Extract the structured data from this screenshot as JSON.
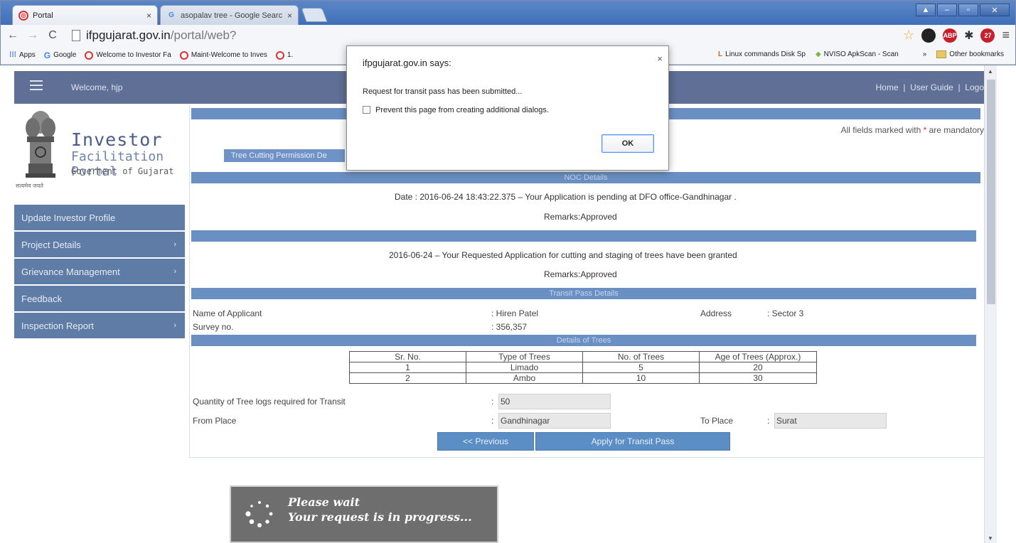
{
  "browser": {
    "tabs": [
      {
        "label": "Portal",
        "close": "×"
      },
      {
        "label": "asopalav tree - Google Searc",
        "close": "×"
      }
    ],
    "window_controls": {
      "user": "▲",
      "minimize": "–",
      "maximize": "▫",
      "close": "✕"
    },
    "address": {
      "host": "ifpgujarat.gov.in",
      "path": "/portal/web?"
    },
    "bookmarks": [
      "Apps",
      "Google",
      "Welcome to Investor Fa",
      "Maint-Welcome to Inves",
      "1.",
      "Linux commands Disk Sp",
      "NVISO ApkScan - Scan"
    ],
    "bookmarks_more": "»",
    "other_bookmarks": "Other bookmarks",
    "ext_badge": "27",
    "abp_label": "ABP"
  },
  "header": {
    "welcome": "Welcome, hjp",
    "links": {
      "home": "Home",
      "guide": "User Guide",
      "logout": "Logout",
      "sep": "|"
    }
  },
  "logo": {
    "line1": "Investor",
    "line2": "Facilitation Portal",
    "line3": "Goverment of Gujarat",
    "motto": "सत्यमेव जयते"
  },
  "sidebar": {
    "items": [
      {
        "label": "Update Investor Profile",
        "arrow": ""
      },
      {
        "label": "Project Details",
        "arrow": "›"
      },
      {
        "label": "Grievance Management",
        "arrow": "›"
      },
      {
        "label": "Feedback",
        "arrow": ""
      },
      {
        "label": "Inspection Report",
        "arrow": "›"
      }
    ]
  },
  "content": {
    "mandatory_note_pre": "All fields marked with ",
    "mandatory_star": "*",
    "mandatory_note_post": " are mandatory",
    "tree_tab": "Tree Cutting Permission De",
    "noc_header": "NOC Details",
    "noc_status": "Date : 2016-06-24 18:43:22.375  –  Your Application is pending at DFO office-Gandhinagar .",
    "noc_remarks": "Remarks:Approved",
    "grant_status": "2016-06-24  –  Your Requested Application for cutting and staging of trees have been granted",
    "grant_remarks": "Remarks:Approved",
    "transit_header": "Transit Pass Details",
    "name_label": "Name of Applicant",
    "name_value": ": Hiren Patel",
    "address_label": "Address",
    "address_value": ": Sector 3",
    "survey_label": "Survey no.",
    "survey_value": ": 356,357",
    "trees_header": "Details of Trees",
    "trees_table": {
      "headers": [
        "Sr. No.",
        "Type of Trees",
        "No. of Trees",
        "Age of Trees (Approx.)"
      ],
      "rows": [
        [
          "1",
          "Limado",
          "5",
          "20"
        ],
        [
          "2",
          "Ambo",
          "10",
          "30"
        ]
      ]
    },
    "quantity_label": "Quantity of Tree logs required for Transit",
    "colon": ":",
    "quantity_value": "50",
    "from_label": "From Place",
    "from_value": "Gandhinagar",
    "to_label": "To Place",
    "to_value": "Surat",
    "prev_button": "<< Previous",
    "apply_button": "Apply for Transit Pass"
  },
  "wait": {
    "line1": "Please wait",
    "line2": "Your request is in progress..."
  },
  "dialog": {
    "title": "ifpgujarat.gov.in says:",
    "close": "×",
    "message": "Request for transit pass has been submitted...",
    "checkbox_label": "Prevent this page from creating additional dialogs.",
    "ok": "OK"
  },
  "colors": {
    "header_bar": "#5f6f95",
    "menu": "#5e7ca6",
    "section_bar": "#6a8fc2",
    "button": "#5b8ec5"
  }
}
